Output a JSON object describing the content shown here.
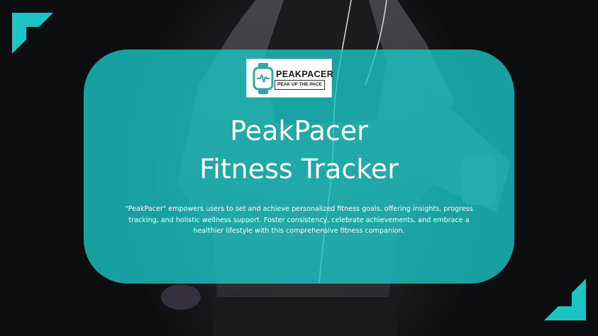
{
  "colors": {
    "accent": "#1cc4c4",
    "background": "#111214",
    "text": "#ffffff"
  },
  "logo": {
    "name": "PEAKPACER",
    "tagline": "PEAK UP THE PACE",
    "icon": "smartwatch-heartbeat-icon"
  },
  "hero": {
    "title_line1": "PeakPacer",
    "title_line2": "Fitness Tracker",
    "description": "\"PeakPacer\" empowers users to set and achieve personalized fitness goals, offering insights, progress tracking, and holistic wellness support. Foster consistency, celebrate achievements, and embrace a healthier lifestyle with this comprehensive fitness companion."
  }
}
